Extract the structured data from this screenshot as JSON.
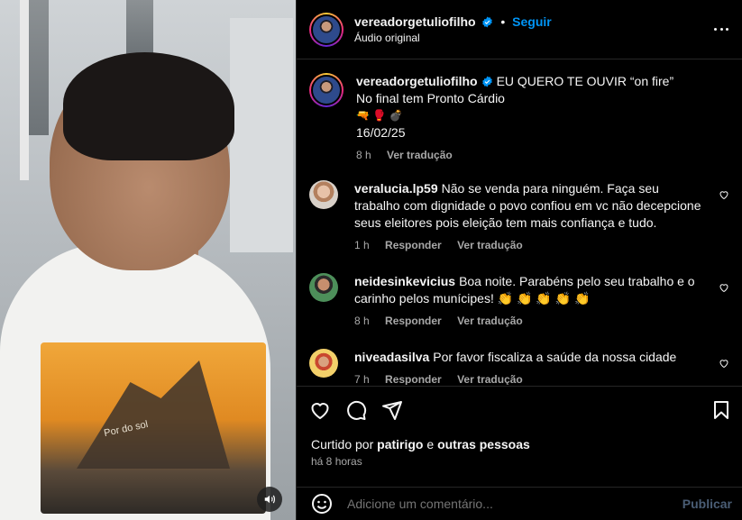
{
  "post": {
    "username": "vereadorgetuliofilho",
    "follow_label": "Seguir",
    "audio": "Áudio original",
    "caption": {
      "text": "EU QUERO TE OUVIR “on fire”",
      "line2": "No final tem Pronto Cárdio",
      "emojis": "🔫 🥊 💣",
      "date": "16/02/25",
      "time": "8 h",
      "translate": "Ver tradução"
    }
  },
  "comments": [
    {
      "user": "veralucia.lp59",
      "text": "Não se venda para ninguém. Faça seu trabalho com dignidade o povo confiou em vc não decepcione seus eleitores pois eleição tem mais confiança e tudo.",
      "time": "1 h",
      "reply": "Responder",
      "translate": "Ver tradução"
    },
    {
      "user": "neidesinkevicius",
      "text": "Boa noite. Parabéns pelo seu trabalho e o carinho pelos munícipes! 👏 👏 👏 👏 👏",
      "time": "8 h",
      "reply": "Responder",
      "translate": "Ver tradução"
    },
    {
      "user": "niveadasilva",
      "text": "Por favor fiscaliza a saúde da nossa cidade",
      "time": "7 h",
      "reply": "Responder",
      "translate": "Ver tradução"
    }
  ],
  "likes": {
    "prefix": "Curtido por",
    "user": "patirigo",
    "joiner": "e",
    "others": "outras pessoas"
  },
  "posted_ago": "há 8 horas",
  "composer": {
    "placeholder": "Adicione um comentário...",
    "post_label": "Publicar"
  },
  "video": {
    "shirt_text": "Por do sol"
  },
  "colors": {
    "accent": "#0095f6",
    "muted": "#a8a8a8",
    "background": "#000000"
  },
  "icons": [
    "verified-icon",
    "more-options-icon",
    "heart-icon",
    "comment-icon",
    "share-icon",
    "bookmark-icon",
    "emoji-icon",
    "sound-icon"
  ]
}
